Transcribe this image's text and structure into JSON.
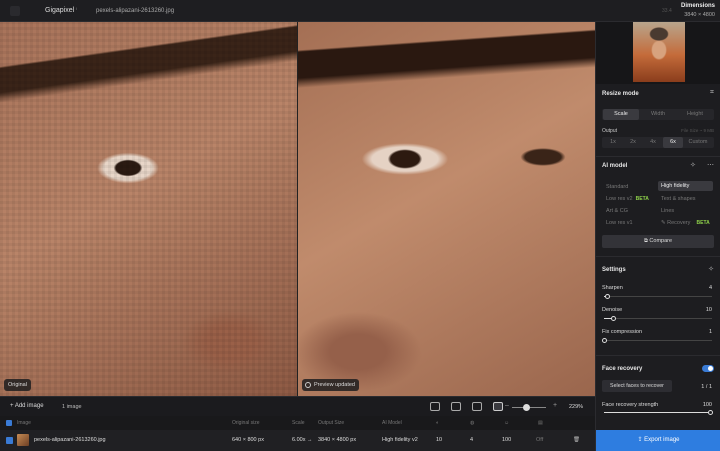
{
  "topbar": {
    "app_name": "Gigapixel",
    "info_glyph": "ⁱ",
    "file_name": "pexels-alipazani-2613260.jpg",
    "window_hint": "33.4",
    "dimensions_label": "Dimensions",
    "dimensions_value": "3840 × 4800"
  },
  "preview": {
    "original_tag": "Original",
    "preview_tag": "Preview updated"
  },
  "toolbar": {
    "add_image": "+ Add image",
    "image_count": "1 image",
    "zoom": "229%",
    "zoom_level": 0.45,
    "zoom_minus": "–",
    "zoom_plus": "+"
  },
  "table": {
    "headers": [
      "Image",
      "Original size",
      "Scale",
      "Output Size",
      "AI Model"
    ],
    "row": {
      "file": "pexels-alipazani-2613260.jpg",
      "original_size": "640 × 800 px",
      "scale": "6.00x →",
      "output_size": "3840 × 4800 px",
      "model": "High fidelity v2",
      "v1": "10",
      "v2": "4",
      "v3": "100",
      "v4": "Off"
    }
  },
  "panel": {
    "resize_mode": "Resize mode",
    "resize_tabs": [
      "Scale",
      "Width",
      "Height"
    ],
    "output_label": "Output",
    "output_hint": "File Size ~ 9 MB",
    "scales": [
      "1x",
      "2x",
      "4x",
      "6x",
      "Custom"
    ],
    "ai_model_label": "AI model",
    "models": {
      "standard": "Standard",
      "high_fidelity": "High fidelity",
      "low_res_v2": "Low res v2",
      "text_shapes": "Text & shapes",
      "art_cg": "Art & CG",
      "lines": "Lines",
      "low_res_v1": "Low res v1",
      "recovery": "Recovery",
      "beta": "BETA"
    },
    "compare": "Compare",
    "settings_label": "Settings",
    "sharpen_label": "Sharpen",
    "sharpen_value": "4",
    "denoise_label": "Denoise",
    "denoise_value": "10",
    "fixcomp_label": "Fix compression",
    "fixcomp_value": "1",
    "face_recovery_label": "Face recovery",
    "select_faces": "Select faces to recover",
    "faces_count": "1 / 1",
    "face_strength_label": "Face recovery strength",
    "face_strength_value": "100",
    "export": "Export image"
  }
}
